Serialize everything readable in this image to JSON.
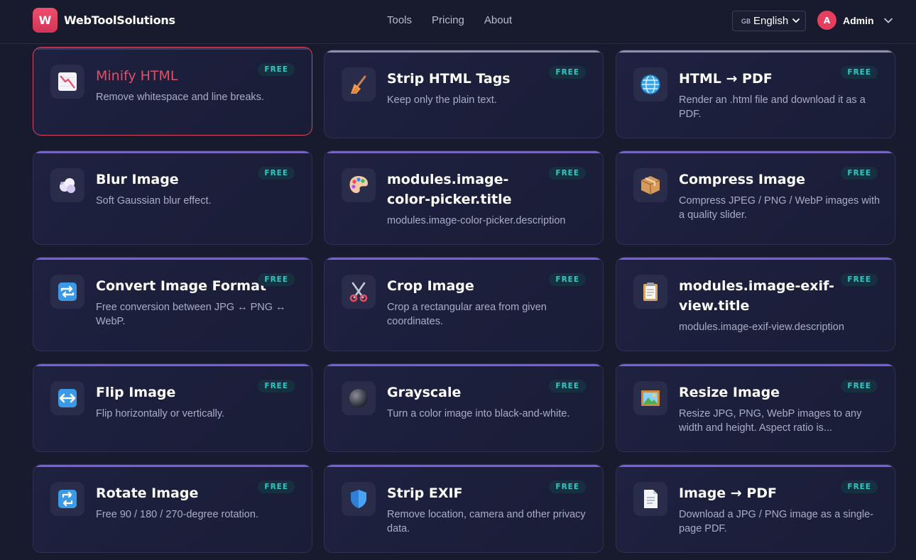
{
  "header": {
    "logo_letter": "W",
    "brand": "WebToolSolutions",
    "nav": [
      "Tools",
      "Pricing",
      "About"
    ],
    "language": {
      "flag": "GB",
      "label": "English"
    },
    "user": {
      "avatar_letter": "A",
      "name": "Admin"
    }
  },
  "badge_label": "FREE",
  "cards": [
    {
      "title": "Minify HTML",
      "description": "Remove whitespace and line breaks.",
      "icon": "chart-down-icon"
    },
    {
      "title": "Strip HTML Tags",
      "description": "Keep only the plain text.",
      "icon": "broom-icon"
    },
    {
      "title": "HTML → PDF",
      "description": "Render an .html file and download it as a PDF.",
      "icon": "globe-icon"
    },
    {
      "title": "Blur Image",
      "description": "Soft Gaussian blur effect.",
      "icon": "cloud-icon"
    },
    {
      "title": "modules.image-color-picker.title",
      "description": "modules.image-color-picker.description",
      "icon": "palette-icon"
    },
    {
      "title": "Compress Image",
      "description": "Compress JPEG / PNG / WebP images with a quality slider.",
      "icon": "package-icon"
    },
    {
      "title": "Convert Image Format",
      "description": "Free conversion between JPG ↔ PNG ↔ WebP.",
      "icon": "repeat-icon"
    },
    {
      "title": "Crop Image",
      "description": "Crop a rectangular area from given coordinates.",
      "icon": "scissors-icon"
    },
    {
      "title": "modules.image-exif-view.title",
      "description": "modules.image-exif-view.description",
      "icon": "clipboard-icon"
    },
    {
      "title": "Flip Image",
      "description": "Flip horizontally or vertically.",
      "icon": "left-right-arrow-icon"
    },
    {
      "title": "Grayscale",
      "description": "Turn a color image into black-and-white.",
      "icon": "black-circle-icon"
    },
    {
      "title": "Resize Image",
      "description": "Resize JPG, PNG, WebP images to any width and height. Aspect ratio is...",
      "icon": "framed-picture-icon"
    },
    {
      "title": "Rotate Image",
      "description": "Free 90 / 180 / 270-degree rotation.",
      "icon": "rotate-icon"
    },
    {
      "title": "Strip EXIF",
      "description": "Remove location, camera and other privacy data.",
      "icon": "shield-icon"
    },
    {
      "title": "Image → PDF",
      "description": "Download a JPG / PNG image as a single-page PDF.",
      "icon": "document-icon"
    }
  ],
  "colors": {
    "background": "#181a2e",
    "accent_purple": "#7b5ce0",
    "brand_red": "#e63e5f",
    "badge_teal": "#2fc7c4"
  }
}
